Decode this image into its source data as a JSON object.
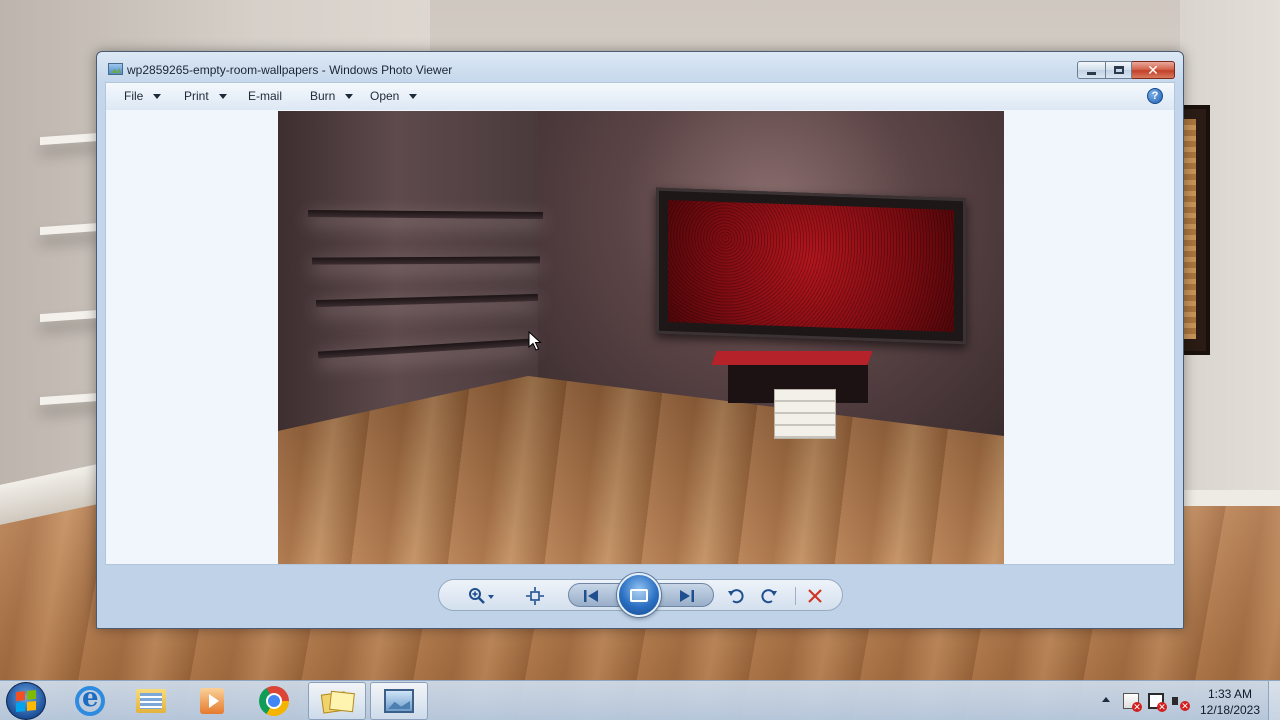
{
  "window": {
    "title": "wp2859265-empty-room-wallpapers - Windows Photo Viewer",
    "minimize_label": "Minimize",
    "maximize_label": "Maximize",
    "close_label": "Close"
  },
  "menu": {
    "file": "File",
    "print": "Print",
    "email": "E-mail",
    "burn": "Burn",
    "open": "Open",
    "help": "?"
  },
  "toolbar": {
    "zoom_icon": "zoom-icon",
    "actual_size_icon": "actual-size-icon",
    "previous_icon": "previous-icon",
    "slideshow_icon": "slideshow-icon",
    "next_icon": "next-icon",
    "rotate_ccw_icon": "rotate-counterclockwise-icon",
    "rotate_cw_icon": "rotate-clockwise-icon",
    "delete_icon": "delete-icon",
    "accent_color": "#1f4f8f",
    "delete_color": "#d03524"
  },
  "taskbar": {
    "apps": [
      "internet-explorer-icon",
      "windows-explorer-icon",
      "media-player-icon",
      "chrome-icon",
      "photos-folder-icon",
      "photo-viewer-icon"
    ],
    "clock": {
      "time": "1:33 AM",
      "date": "12/18/2023"
    }
  }
}
